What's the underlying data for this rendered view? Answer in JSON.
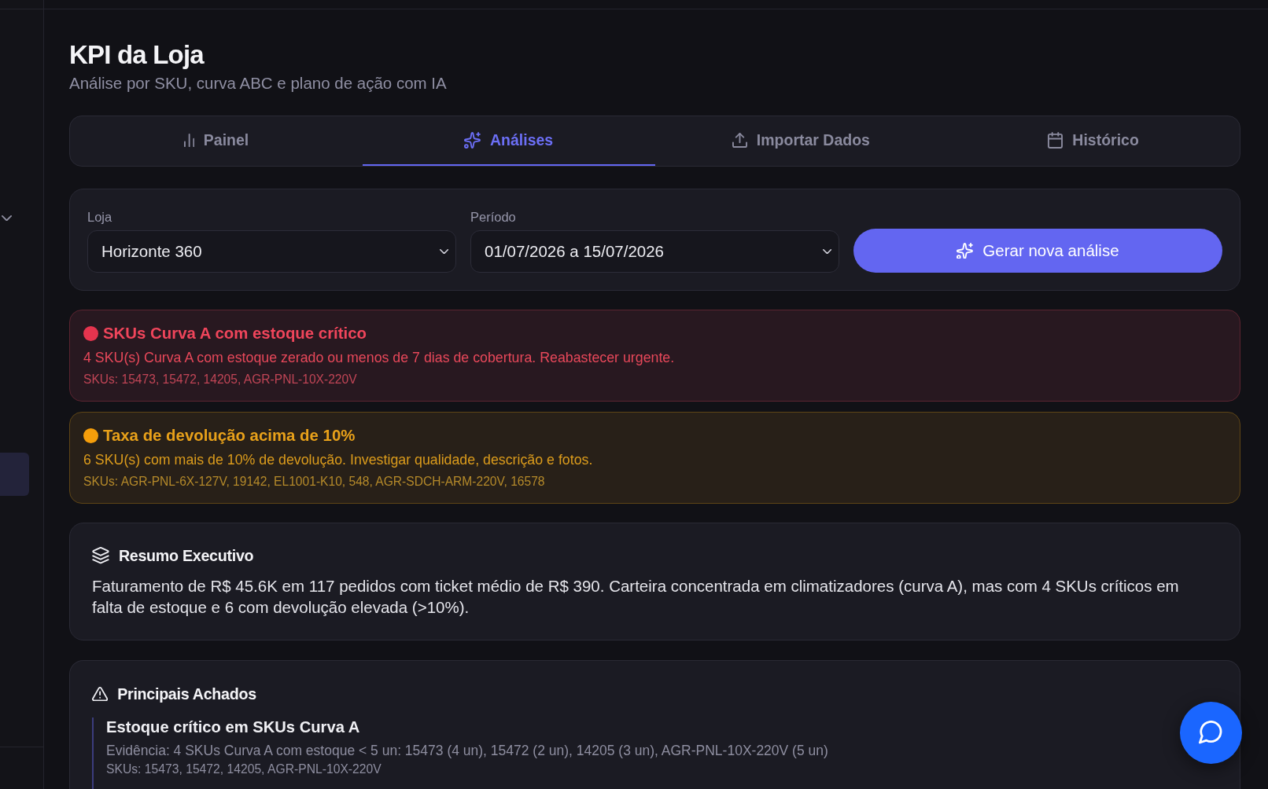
{
  "sidebar": {
    "items": [
      {
        "selected": true
      }
    ]
  },
  "header": {
    "title": "KPI da Loja",
    "subtitle": "Análise por SKU, curva ABC e plano de ação com IA"
  },
  "tabs": [
    {
      "label": "Painel",
      "selected": false
    },
    {
      "label": "Análises",
      "selected": true
    },
    {
      "label": "Importar Dados",
      "selected": false
    },
    {
      "label": "Histórico",
      "selected": false
    }
  ],
  "filters": {
    "fields": [
      {
        "label": "Loja",
        "value": "Horizonte 360"
      },
      {
        "label": "Período",
        "value": "01/07/2026 a 15/07/2026"
      }
    ],
    "generate_button": "Gerar nova análise"
  },
  "alerts": [
    {
      "kind": "critical",
      "color": "#e5344e",
      "title": "SKUs Curva A com estoque crítico",
      "message": "4 SKU(s) Curva A com estoque zerado ou menos de 7 dias de cobertura. Reabastecer urgente.",
      "skus": "SKUs: 15473, 15472, 14205, AGR-PNL-10X-220V"
    },
    {
      "kind": "warning",
      "color": "#f59e0b",
      "title": "Taxa de devolução acima de 10%",
      "message": "6 SKU(s) com mais de 10% de devolução. Investigar qualidade, descrição e fotos.",
      "skus": "SKUs: AGR-PNL-6X-127V, 19142, EL1001-K10, 548, AGR-SDCH-ARM-220V, 16578"
    }
  ],
  "summary": {
    "title": "Resumo Executivo",
    "text": "Faturamento de R$ 45.6K em 117 pedidos com ticket médio de R$ 390. Carteira concentrada em climatizadores (curva A), mas com 4 SKUs críticos em falta de estoque e 6 com devolução elevada (>10%)."
  },
  "findings": {
    "title": "Principais Achados",
    "items": [
      {
        "title": "Estoque crítico em SKUs Curva A",
        "evidence": "Evidência: 4 SKUs Curva A com estoque < 5 un: 15473 (4 un), 15472 (2 un), 14205 (3 un), AGR-PNL-10X-220V (5 un)",
        "skus": "SKUs: 15473, 15472, 14205, AGR-PNL-10X-220V"
      }
    ]
  }
}
